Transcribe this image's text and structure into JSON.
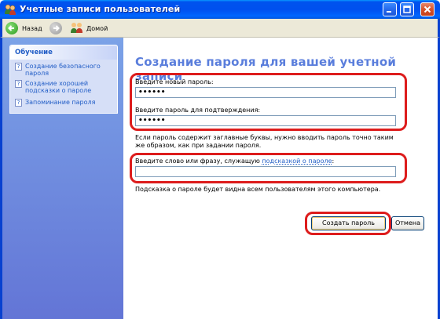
{
  "window": {
    "title": "Учетные записи пользователей",
    "icon": "users-icon"
  },
  "toolbar": {
    "back_label": "Назад",
    "home_label": "Домой"
  },
  "sidebar": {
    "panel_title": "Обучение",
    "items": [
      {
        "label": "Создание безопасного пароля"
      },
      {
        "label": "Создание хорошей подсказки о пароле"
      },
      {
        "label": "Запоминание пароля"
      }
    ]
  },
  "main": {
    "heading": "Создание пароля для вашей учетной записи",
    "new_password_label": "Введите новый пароль:",
    "new_password_value": "••••••",
    "confirm_password_label": "Введите пароль для подтверждения:",
    "confirm_password_value": "••••••",
    "case_note": "Если пароль содержит заглавные буквы, нужно вводить пароль точно таким же образом, как при задании пароля.",
    "hint_label": "Введите слово или фразу, служащую",
    "hint_link": "подсказкой о пароле",
    "hint_colon": ":",
    "hint_value": "",
    "hint_note": "Подсказка о пароле будет видна всем пользователям этого компьютера.",
    "create_button": "Создать пароль",
    "cancel_button": "Отмена"
  },
  "colors": {
    "titlebar": "#0053ee",
    "sidebar": "#6375d6",
    "heading": "#5a7edc",
    "highlight": "#dd1c1c"
  }
}
